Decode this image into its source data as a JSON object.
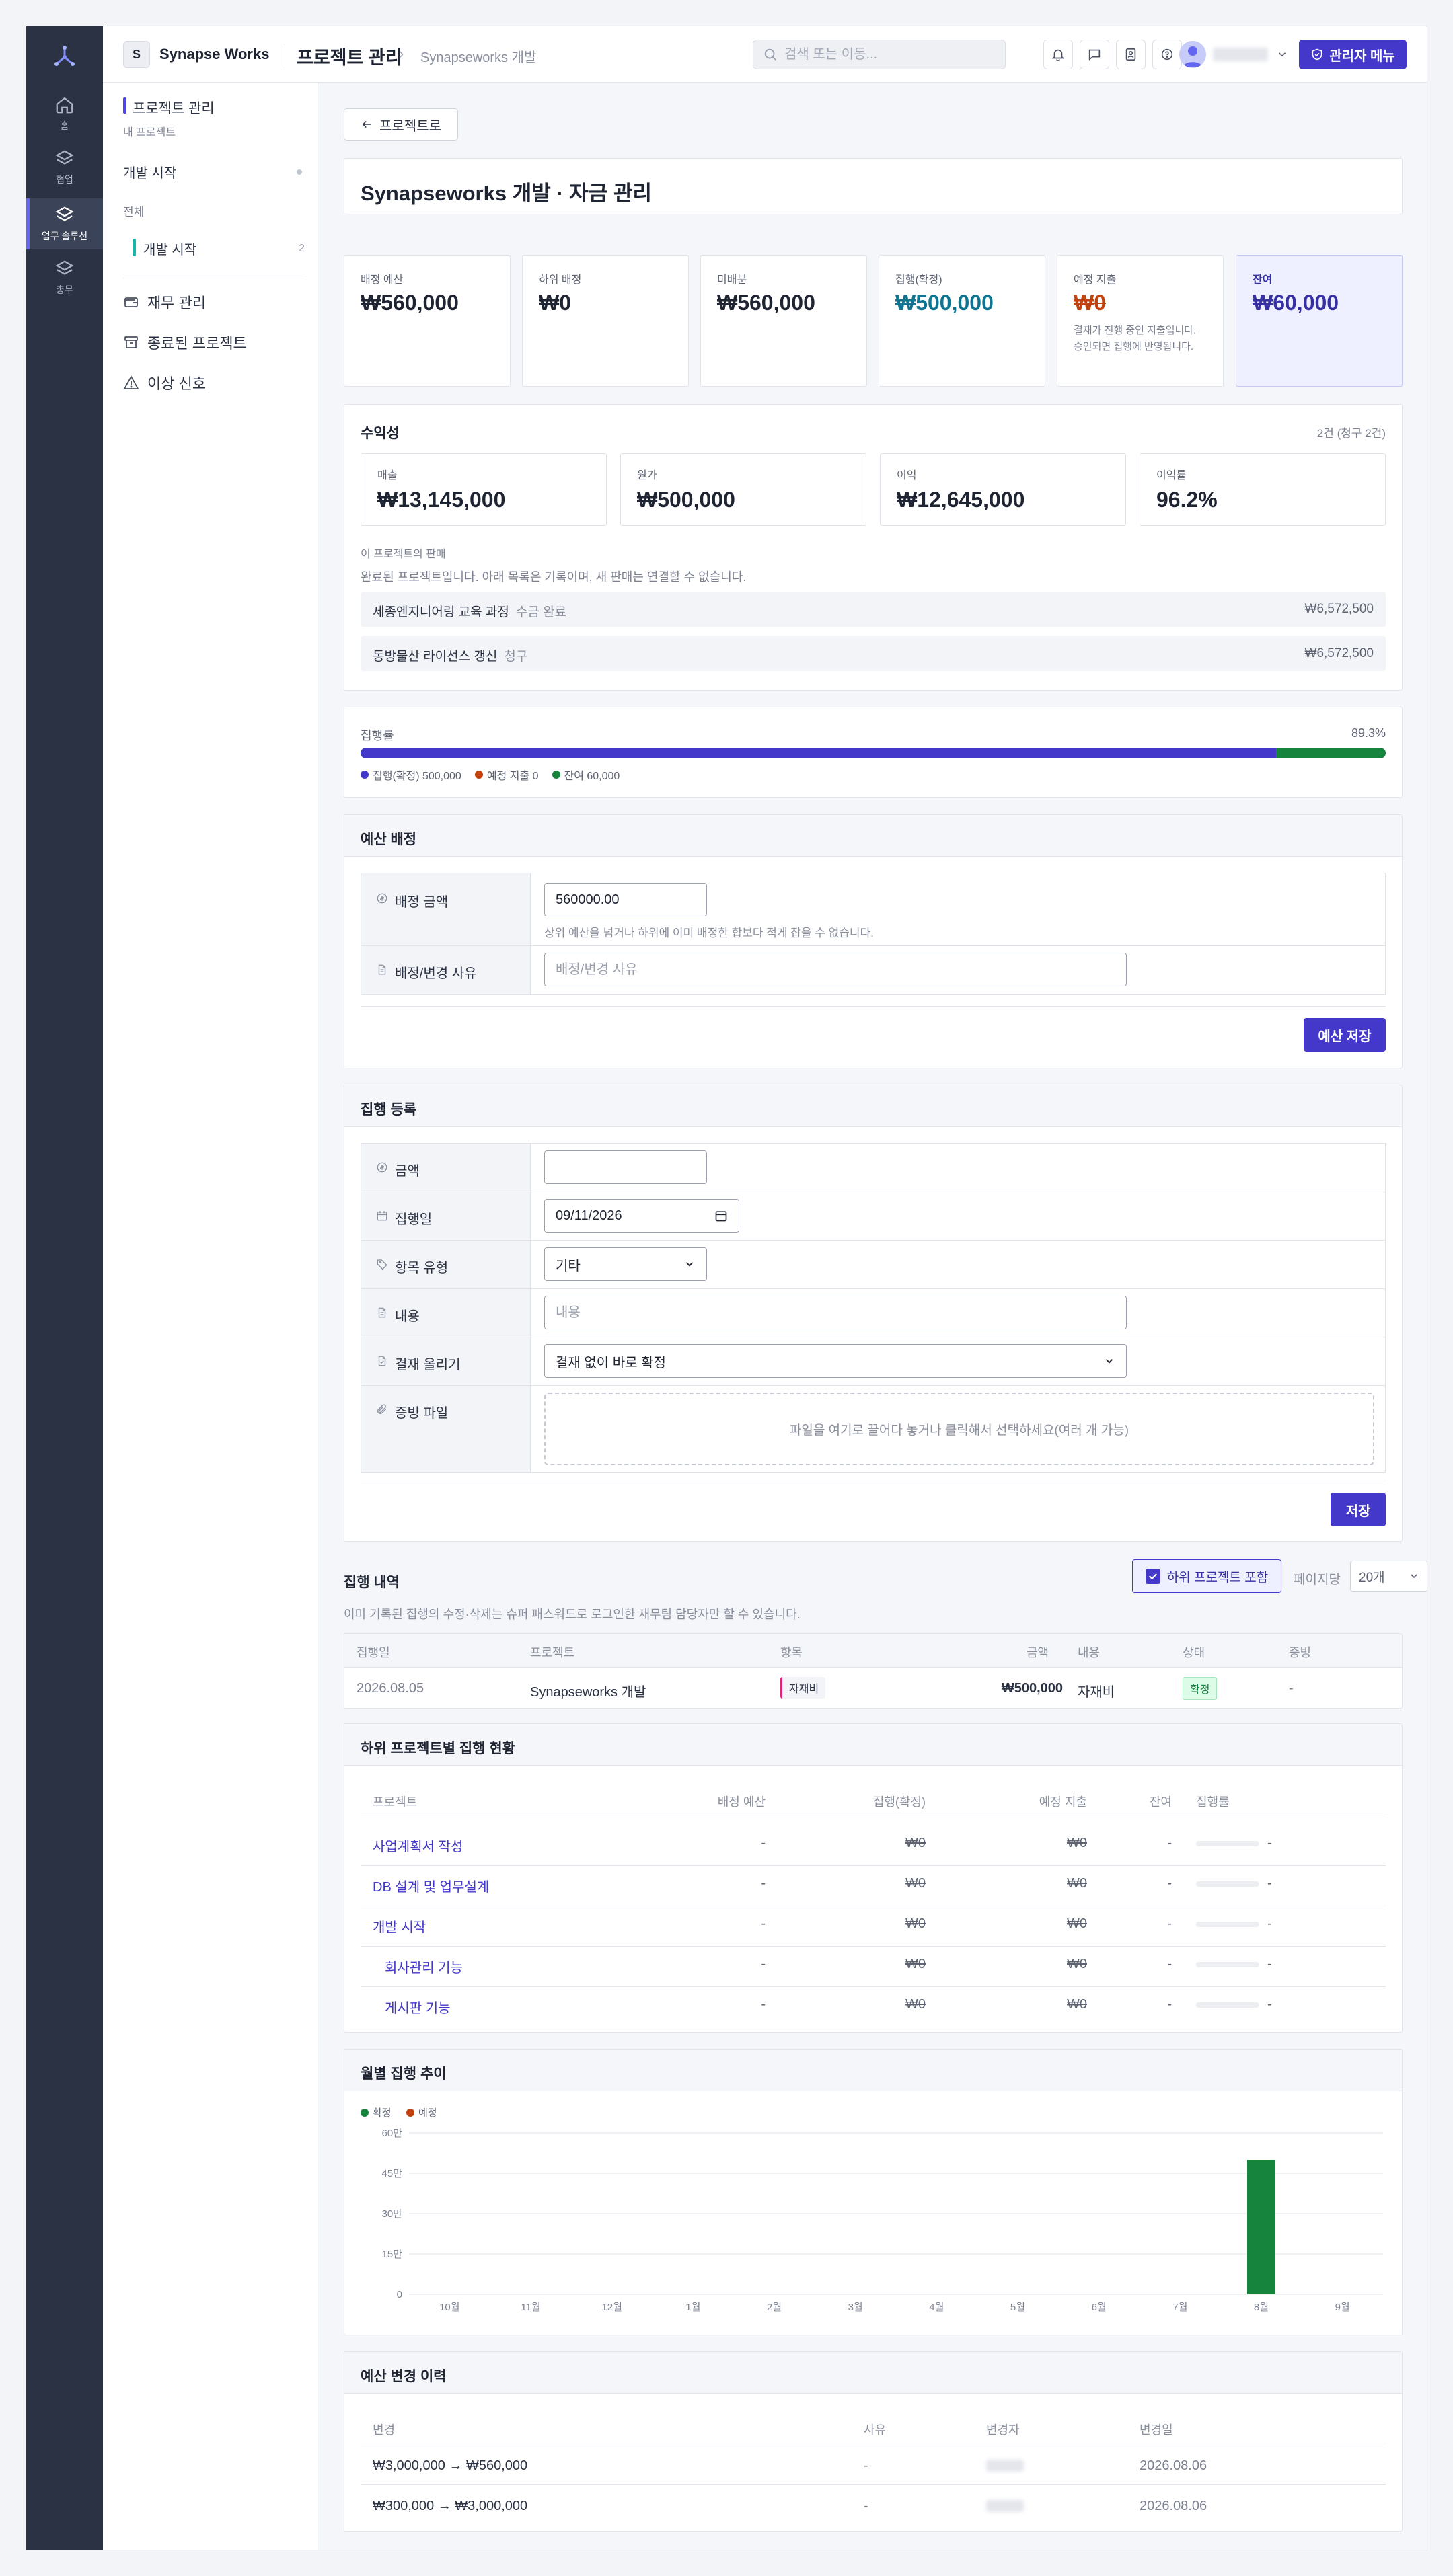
{
  "workspace": {
    "initial": "S",
    "name": "Synapse Works"
  },
  "rail": {
    "items": [
      {
        "label": "홈"
      },
      {
        "label": "협업"
      },
      {
        "label": "업무 솔루션"
      },
      {
        "label": "총무"
      }
    ]
  },
  "topbar": {
    "title": "프로젝트 관리",
    "breadcrumb": "Synapseworks 개발",
    "search_placeholder": "검색 또는 이동...",
    "admin_label": "관리자 메뉴"
  },
  "sidenav": {
    "section": "프로젝트 관리",
    "sub": "내 프로젝트",
    "group": "개발 시작",
    "filter_label": "전체",
    "selected": {
      "label": "개발 시작",
      "count": "2"
    },
    "links": [
      {
        "label": "재무 관리"
      },
      {
        "label": "종료된 프로젝트"
      },
      {
        "label": "이상 신호"
      }
    ]
  },
  "page": {
    "back_label": "프로젝트로",
    "title": "Synapseworks 개발 · 자금 관리"
  },
  "stats": [
    {
      "label": "배정 예산",
      "value": "₩560,000"
    },
    {
      "label": "하위 배정",
      "value": "₩0"
    },
    {
      "label": "미배분",
      "value": "₩560,000"
    },
    {
      "label": "집행(확정)",
      "value": "₩500,000"
    },
    {
      "label": "예정 지출",
      "value": "₩0",
      "note": "결재가 진행 중인 지출입니다. 승인되면 집행에 반영됩니다."
    },
    {
      "label": "잔여",
      "value": "₩60,000"
    }
  ],
  "profit": {
    "title": "수익성",
    "count": "2건 (청구 2건)",
    "cards": [
      {
        "label": "매출",
        "value": "₩13,145,000"
      },
      {
        "label": "원가",
        "value": "₩500,000"
      },
      {
        "label": "이익",
        "value": "₩12,645,000"
      },
      {
        "label": "이익률",
        "value": "96.2%"
      }
    ],
    "sales_label": "이 프로젝트의 판매",
    "sales_note": "완료된 프로젝트입니다. 아래 목록은 기록이며, 새 판매는 연결할 수 없습니다.",
    "sales": [
      {
        "name": "세종엔지니어링 교육 과정",
        "status": "수금 완료",
        "amount": "₩6,572,500"
      },
      {
        "name": "동방물산 라이선스 갱신",
        "status": "청구",
        "amount": "₩6,572,500"
      }
    ]
  },
  "execution": {
    "label": "집행률",
    "rate_text": "89.3%",
    "rate": 0.893,
    "legend": [
      {
        "label": "집행(확정) 500,000",
        "color": "#4338ca"
      },
      {
        "label": "예정 지출 0",
        "color": "#c2410c"
      },
      {
        "label": "잔여 60,000",
        "color": "#16843d"
      }
    ]
  },
  "budget_form": {
    "title": "예산 배정",
    "amount_label": "배정 금액",
    "amount_value": "560000.00",
    "amount_hint": "상위 예산을 넘거나 하위에 이미 배정한 합보다 적게 잡을 수 없습니다.",
    "reason_label": "배정/변경 사유",
    "reason_placeholder": "배정/변경 사유",
    "save_label": "예산 저장"
  },
  "expense_form": {
    "title": "집행 등록",
    "amount_label": "금액",
    "date_label": "집행일",
    "date_value": "09/11/2026",
    "type_label": "항목 유형",
    "type_value": "기타",
    "content_label": "내용",
    "content_placeholder": "내용",
    "approval_label": "결재 올리기",
    "approval_value": "결재 없이 바로 확정",
    "file_label": "증빙 파일",
    "file_hint": "파일을 여기로 끌어다 놓거나 클릭해서 선택하세요(여러 개 가능)",
    "save_label": "저장"
  },
  "history": {
    "title": "집행 내역",
    "include_sub": "하위 프로젝트 포함",
    "per_page_label": "페이지당",
    "per_page_value": "20개",
    "note": "이미 기록된 집행의 수정·삭제는 슈퍼 패스워드로 로그인한 재무팀 담당자만 할 수 있습니다.",
    "columns": [
      "집행일",
      "프로젝트",
      "항목",
      "금액",
      "내용",
      "상태",
      "증빙"
    ],
    "rows": [
      {
        "date": "2026.08.05",
        "project": "Synapseworks 개발",
        "item": "자재비",
        "amount": "₩500,000",
        "content": "자재비",
        "status": "확정",
        "proof": "-"
      }
    ]
  },
  "subprojects": {
    "title": "하위 프로젝트별 집행 현황",
    "columns": [
      "프로젝트",
      "배정 예산",
      "집행(확정)",
      "예정 지출",
      "잔여",
      "집행률"
    ],
    "rows": [
      {
        "name": "사업계획서 작성",
        "budget": "-",
        "spent": "₩0",
        "planned": "₩0",
        "remain": "-",
        "rate": "-"
      },
      {
        "name": "DB 설계 및 업무설계",
        "budget": "-",
        "spent": "₩0",
        "planned": "₩0",
        "remain": "-",
        "rate": "-"
      },
      {
        "name": "개발 시작",
        "budget": "-",
        "spent": "₩0",
        "planned": "₩0",
        "remain": "-",
        "rate": "-"
      },
      {
        "name": "회사관리 기능",
        "budget": "-",
        "spent": "₩0",
        "planned": "₩0",
        "remain": "-",
        "rate": "-"
      },
      {
        "name": "게시판 기능",
        "budget": "-",
        "spent": "₩0",
        "planned": "₩0",
        "remain": "-",
        "rate": "-"
      }
    ]
  },
  "monthly": {
    "title": "월별 집행 추이"
  },
  "chart_data": {
    "type": "bar",
    "categories": [
      "10월",
      "11월",
      "12월",
      "1월",
      "2월",
      "3월",
      "4월",
      "5월",
      "6월",
      "7월",
      "8월",
      "9월"
    ],
    "series": [
      {
        "name": "확정",
        "color": "#16843d",
        "values": [
          0,
          0,
          0,
          0,
          0,
          0,
          0,
          0,
          0,
          0,
          500000,
          0
        ]
      },
      {
        "name": "예정",
        "color": "#c2410c",
        "values": [
          0,
          0,
          0,
          0,
          0,
          0,
          0,
          0,
          0,
          0,
          0,
          0
        ]
      }
    ],
    "ylim": [
      0,
      600000
    ],
    "yticks": [
      0,
      150000,
      300000,
      450000,
      600000
    ],
    "ytick_labels": [
      "0",
      "15만",
      "30만",
      "45만",
      "60만"
    ],
    "grid": true,
    "legend_position": "top-left"
  },
  "budget_history": {
    "title": "예산 변경 이력",
    "columns": [
      "변경",
      "사유",
      "변경자",
      "변경일"
    ],
    "rows": [
      {
        "change": "₩3,000,000 → ₩560,000",
        "reason": "-",
        "date": "2026.08.06"
      },
      {
        "change": "₩300,000 → ₩3,000,000",
        "reason": "-",
        "date": "2026.08.06"
      }
    ]
  }
}
